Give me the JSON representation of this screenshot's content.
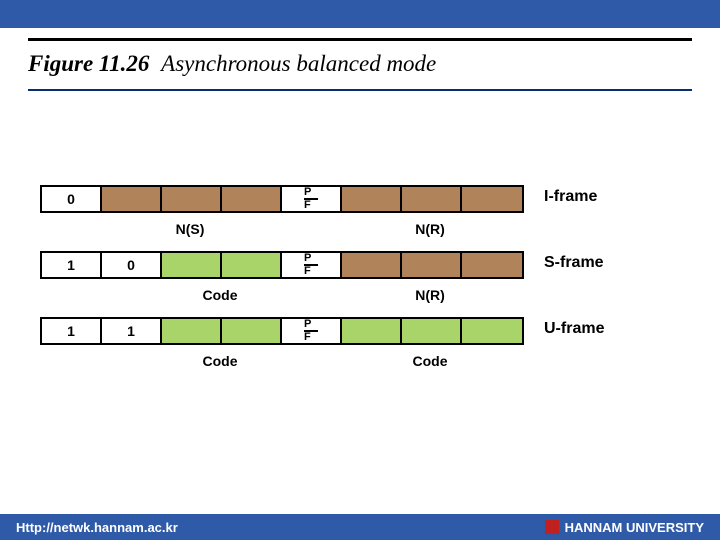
{
  "title": {
    "label": "Figure 11.26",
    "caption": "Asynchronous balanced mode"
  },
  "frames": {
    "iframe": {
      "bits": {
        "b0": "0"
      },
      "labels": {
        "ns": "N(S)",
        "pf_p": "P",
        "pf_f": "F",
        "nr": "N(R)"
      },
      "name": "I-frame"
    },
    "sframe": {
      "bits": {
        "b0": "1",
        "b1": "0"
      },
      "labels": {
        "code": "Code",
        "pf_p": "P",
        "pf_f": "F",
        "nr": "N(R)"
      },
      "name": "S-frame"
    },
    "uframe": {
      "bits": {
        "b0": "1",
        "b1": "1"
      },
      "labels": {
        "code1": "Code",
        "pf_p": "P",
        "pf_f": "F",
        "code2": "Code"
      },
      "name": "U-frame"
    }
  },
  "footer": {
    "url": "Http://netwk.hannam.ac.kr",
    "university": "HANNAM  UNIVERSITY"
  }
}
